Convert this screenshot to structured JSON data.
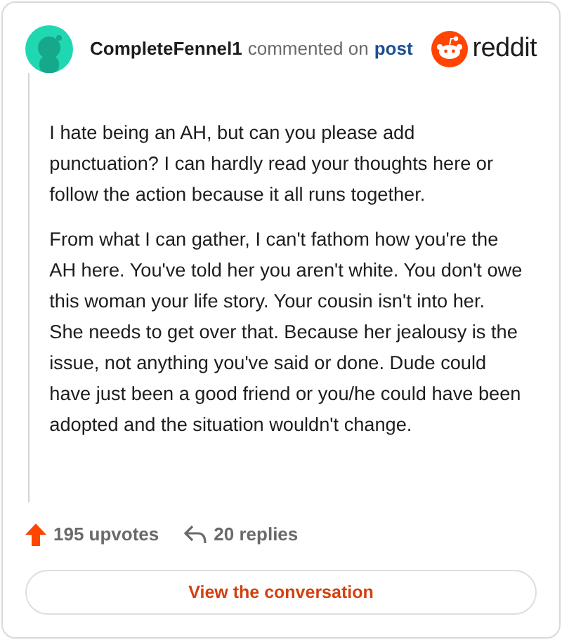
{
  "comment": {
    "author": "CompleteFennel1",
    "action": "commented on",
    "link": "post",
    "brand": "reddit",
    "paragraphs": [
      "I hate being an AH, but can you please add punctuation? I can hardly read your thoughts here or follow the action because it all runs together.",
      "From what I can gather, I can't fathom how you're the AH here. You've told her you aren't white. You don't owe this woman your life story. Your cousin isn't into her. She needs to get over that. Because her jealousy is the issue, not anything you've said or done. Dude could have just been a good friend or you/he could have been adopted and the situation wouldn't change."
    ],
    "upvotes": "195 upvotes",
    "replies": "20 replies"
  },
  "button": "View the conversation"
}
